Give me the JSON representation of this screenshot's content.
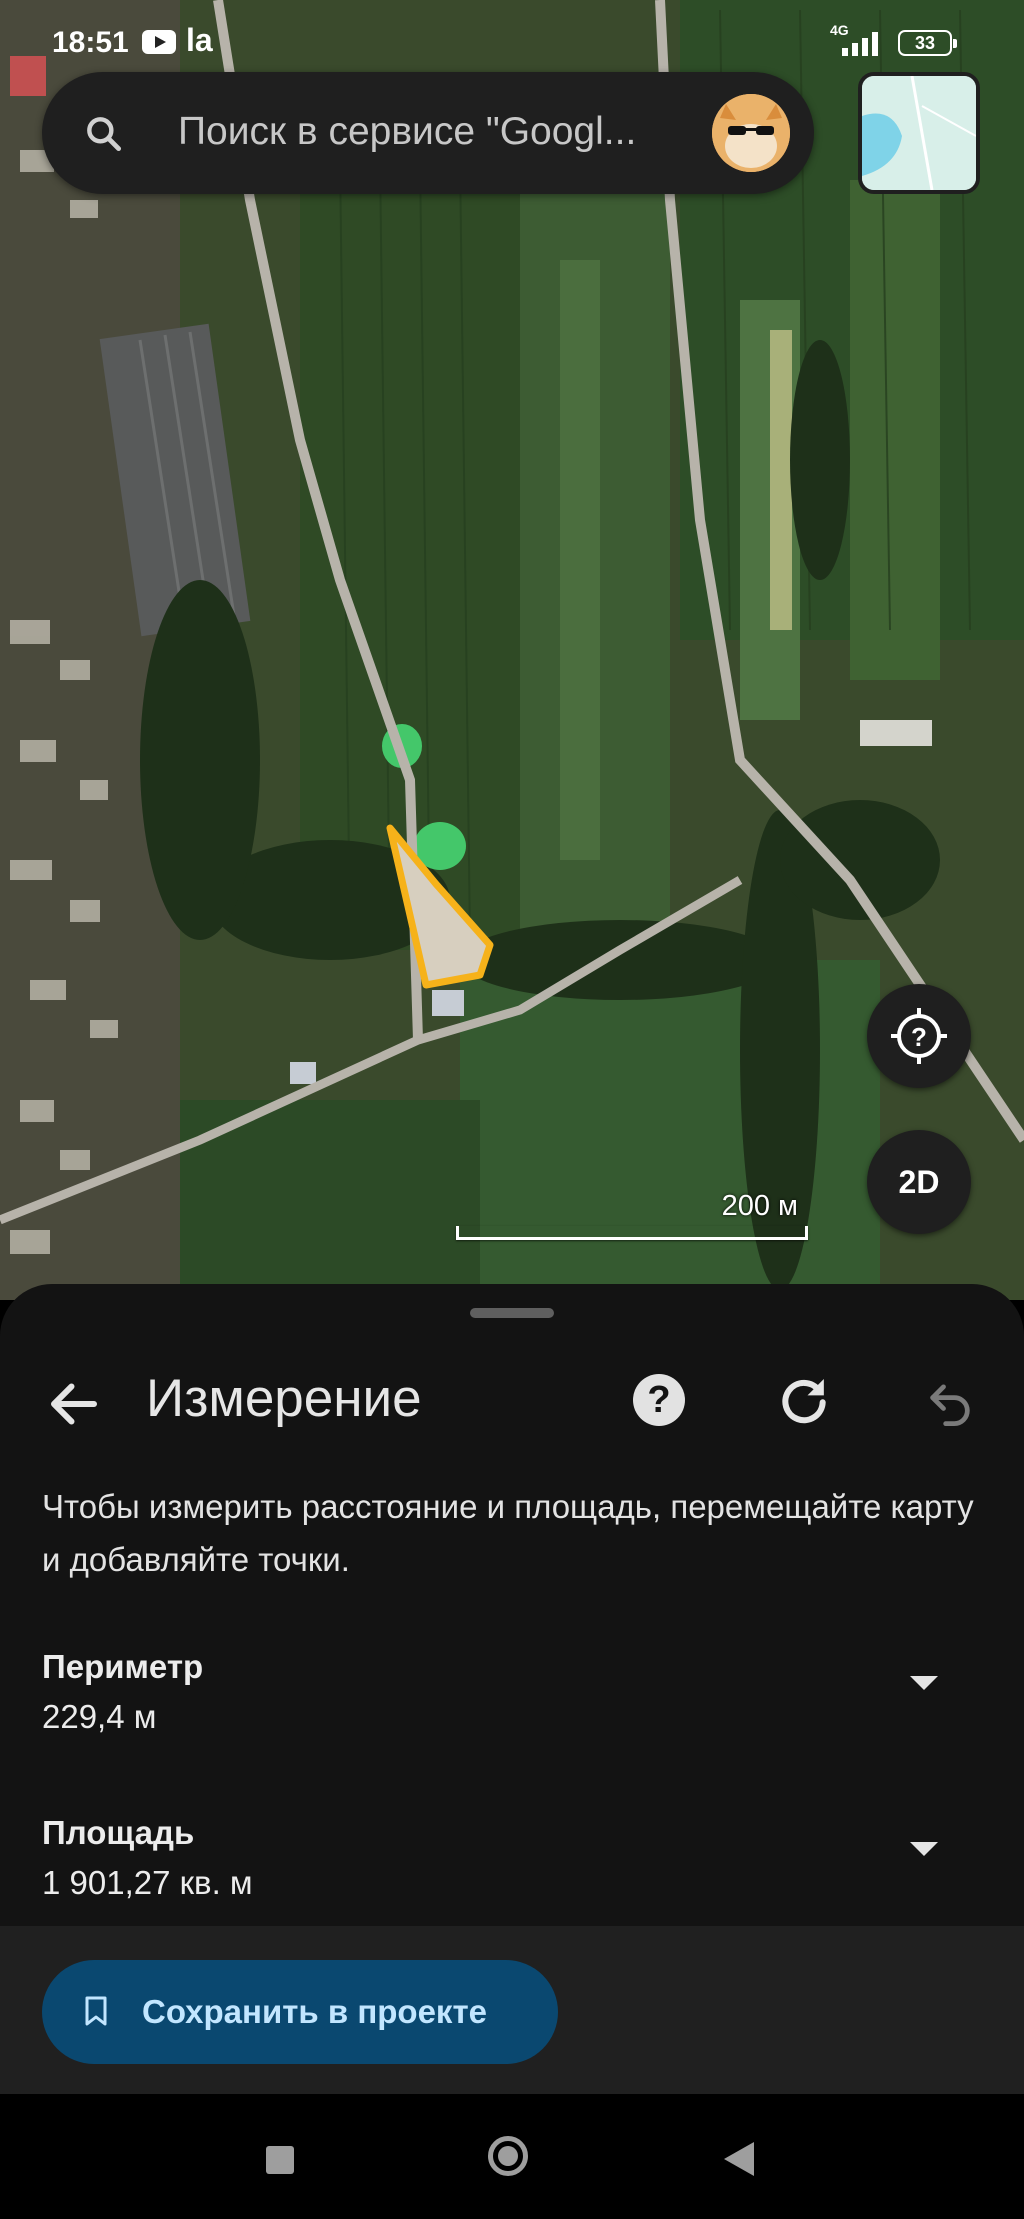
{
  "status_bar": {
    "time": "18:51",
    "carrier_glyph": "la",
    "network": "4G",
    "battery": "33"
  },
  "search": {
    "placeholder": "Поиск в сервисе \"Googl..."
  },
  "map": {
    "scale_label": "200 м",
    "view_mode_label": "2D",
    "polygon_color": "#f6b21a"
  },
  "measurement": {
    "title": "Измерение",
    "hint": "Чтобы измерить расстояние и площадь, перемещайте карту и добавляйте точки.",
    "perimeter": {
      "label": "Периметр",
      "value": "229,4 м"
    },
    "area": {
      "label": "Площадь",
      "value": "1 901,27 кв. м"
    },
    "save_button": "Сохранить в проекте"
  },
  "icons": [
    "search-icon",
    "avatar",
    "map-thumbnail",
    "my-location-icon",
    "back-arrow-icon",
    "help-icon",
    "refresh-icon",
    "undo-icon",
    "bookmark-icon",
    "chevron-down-icon"
  ],
  "colors": {
    "sheet_bg": "#131313",
    "save_button_bg": "#0a4870",
    "save_button_text": "#c2e6ff"
  }
}
